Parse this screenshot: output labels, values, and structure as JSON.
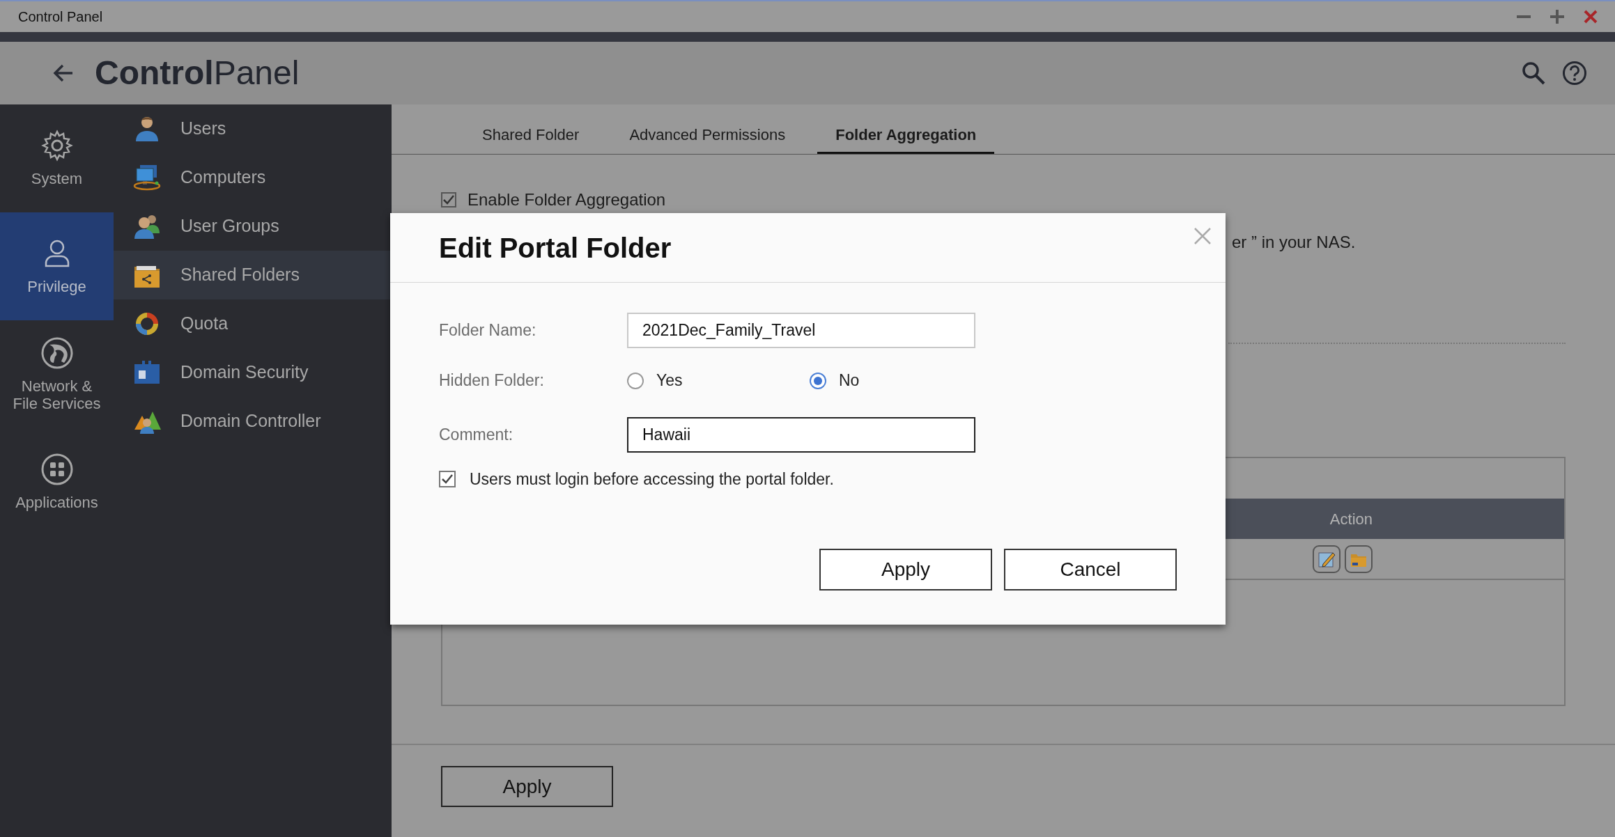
{
  "window": {
    "title": "Control Panel"
  },
  "header": {
    "title_bold": "Control",
    "title_light": "Panel"
  },
  "categories": [
    {
      "label": "System",
      "selected": false
    },
    {
      "label": "Privilege",
      "selected": true
    },
    {
      "label": "Network & File Services",
      "selected": false
    },
    {
      "label": "Applications",
      "selected": false
    }
  ],
  "menu": [
    {
      "label": "Users",
      "selected": false
    },
    {
      "label": "Computers",
      "selected": false
    },
    {
      "label": "User Groups",
      "selected": false
    },
    {
      "label": "Shared Folders",
      "selected": true
    },
    {
      "label": "Quota",
      "selected": false
    },
    {
      "label": "Domain Security",
      "selected": false
    },
    {
      "label": "Domain Controller",
      "selected": false
    }
  ],
  "tabs": [
    {
      "label": "Shared Folder",
      "selected": false
    },
    {
      "label": "Advanced Permissions",
      "selected": false
    },
    {
      "label": "Folder Aggregation",
      "selected": true
    }
  ],
  "aggregation": {
    "label": "Enable Folder Aggregation",
    "checked": true
  },
  "note_fragment": "er ” in your NAS.",
  "table": {
    "columns": [
      "Action"
    ]
  },
  "apply_button": "Apply",
  "dialog": {
    "title": "Edit Portal Folder",
    "fields": [
      {
        "kind": "text",
        "label": "Folder Name:",
        "value": "2021Dec_Family_Travel",
        "focused": false
      },
      {
        "kind": "radio",
        "label": "Hidden Folder:",
        "options": [
          {
            "label": "Yes",
            "selected": false
          },
          {
            "label": "No",
            "selected": true
          }
        ]
      },
      {
        "kind": "text",
        "label": "Comment:",
        "value": "Hawaii",
        "focused": true
      }
    ],
    "login_required": {
      "label": "Users must login before accessing the portal folder.",
      "checked": true
    },
    "buttons": [
      "Apply",
      "Cancel"
    ]
  }
}
